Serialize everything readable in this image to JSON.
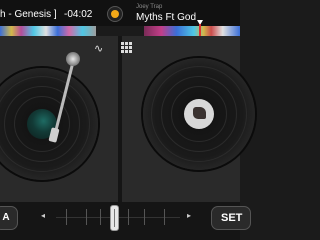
{
  "left_deck": {
    "track_title": "h - Genesis ]",
    "time_remaining": "-04:02"
  },
  "right_deck": {
    "artist": "Joey Trap",
    "track_title": "Myths Ft God"
  },
  "bottom": {
    "fx_label": "A",
    "arrow_left": "◂",
    "arrow_right": "▸",
    "set_label": "SET",
    "crossfader_position": 0.45
  },
  "icons": {
    "center": "record-icon",
    "waveform": "waveform-icon",
    "grid": "grid-icon",
    "wave_glyph": "∿"
  },
  "colors": {
    "accent": "#f2a818",
    "playhead": "#e03030"
  }
}
